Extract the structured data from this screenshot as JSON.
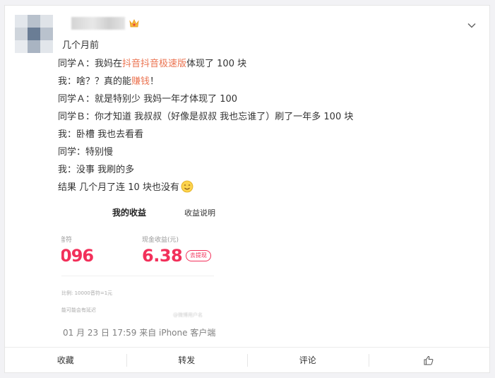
{
  "post": {
    "time_ago": "几个月前",
    "lines": [
      {
        "parts": [
          {
            "t": "同学Ａ：我妈在",
            "hl": false
          },
          {
            "t": "抖音抖音极速版",
            "hl": true
          },
          {
            "t": "体现了 100 块",
            "hl": false
          }
        ]
      },
      {
        "parts": [
          {
            "t": "我：啥？？真的能",
            "hl": false
          },
          {
            "t": "赚钱",
            "hl": true
          },
          {
            "t": "！",
            "hl": false
          }
        ]
      },
      {
        "parts": [
          {
            "t": "同学Ａ：就是特别少 我妈一年才体现了 100",
            "hl": false
          }
        ]
      },
      {
        "parts": [
          {
            "t": "同学Ｂ：你才知道 我叔叔（好像是叔叔 我也忘谁了）刷了一年多 100 块",
            "hl": false
          }
        ]
      },
      {
        "parts": [
          {
            "t": "我：卧槽 我也去看看",
            "hl": false
          }
        ]
      },
      {
        "parts": [
          {
            "t": "同学：特别慢",
            "hl": false
          }
        ]
      },
      {
        "parts": [
          {
            "t": "我：没事 我刷的多",
            "hl": false
          }
        ]
      },
      {
        "parts": [
          {
            "t": "结果 几个月了连 10 块也没有",
            "hl": false
          }
        ],
        "emoji": "smile-emoji"
      }
    ],
    "meta": "01 月 23 日 17:59  来自 iPhone 客户端",
    "highlight_color": "#eb7350"
  },
  "screenshot": {
    "tab_active": "我的收益",
    "tab_other": "收益说明",
    "label_left": "音符",
    "label_right": "现金收益(元)",
    "value_left": "096",
    "value_right": "6.38",
    "withdraw_pill": "去提现",
    "note_rate": "比例: 10000音符=1元",
    "note_delay": "能可能会有延迟",
    "watermark": "@微博用户名",
    "accent_color": "#f2305a"
  },
  "actions": [
    {
      "label": "收藏",
      "name": "favorite-button"
    },
    {
      "label": "转发",
      "name": "repost-button"
    },
    {
      "label": "评论",
      "name": "comment-button"
    },
    {
      "label": "",
      "name": "like-button",
      "icon": "thumbs-up-icon"
    }
  ]
}
